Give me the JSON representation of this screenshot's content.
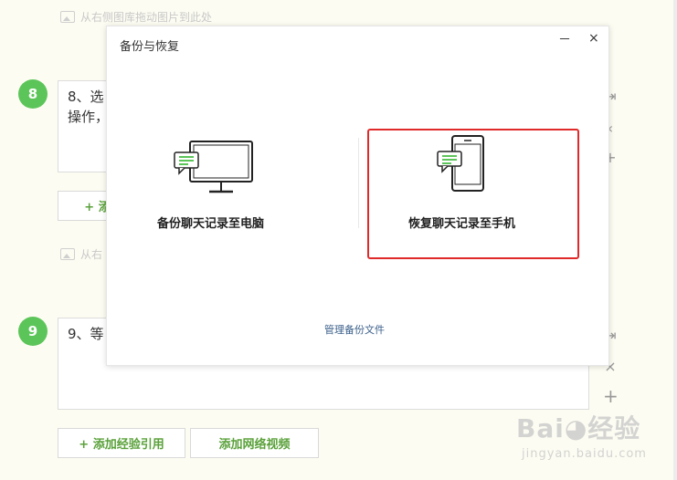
{
  "editor": {
    "img_hint_1": "从右侧图库拖动图片到此处",
    "img_hint_2_partial": "从右",
    "step8": {
      "num": "8",
      "text": "8、选\n操作，"
    },
    "add_btn_partial": "+ 添加",
    "step9": {
      "num": "9",
      "text": "9、等"
    },
    "btn_ref": "+ 添加经验引用",
    "btn_video": "添加网络视频"
  },
  "modal": {
    "title": "备份与恢复",
    "minimize": "－",
    "close": "×",
    "option_pc": "备份聊天记录至电脑",
    "option_phone": "恢复聊天记录至手机",
    "manage_link": "管理备份文件"
  },
  "watermark": {
    "logo": "Bai◕经验",
    "url": "jingyan.baidu.com"
  },
  "colors": {
    "accent_green": "#5cc55a",
    "highlight_red": "#e02a2a",
    "link_blue": "#3a5f8a"
  }
}
